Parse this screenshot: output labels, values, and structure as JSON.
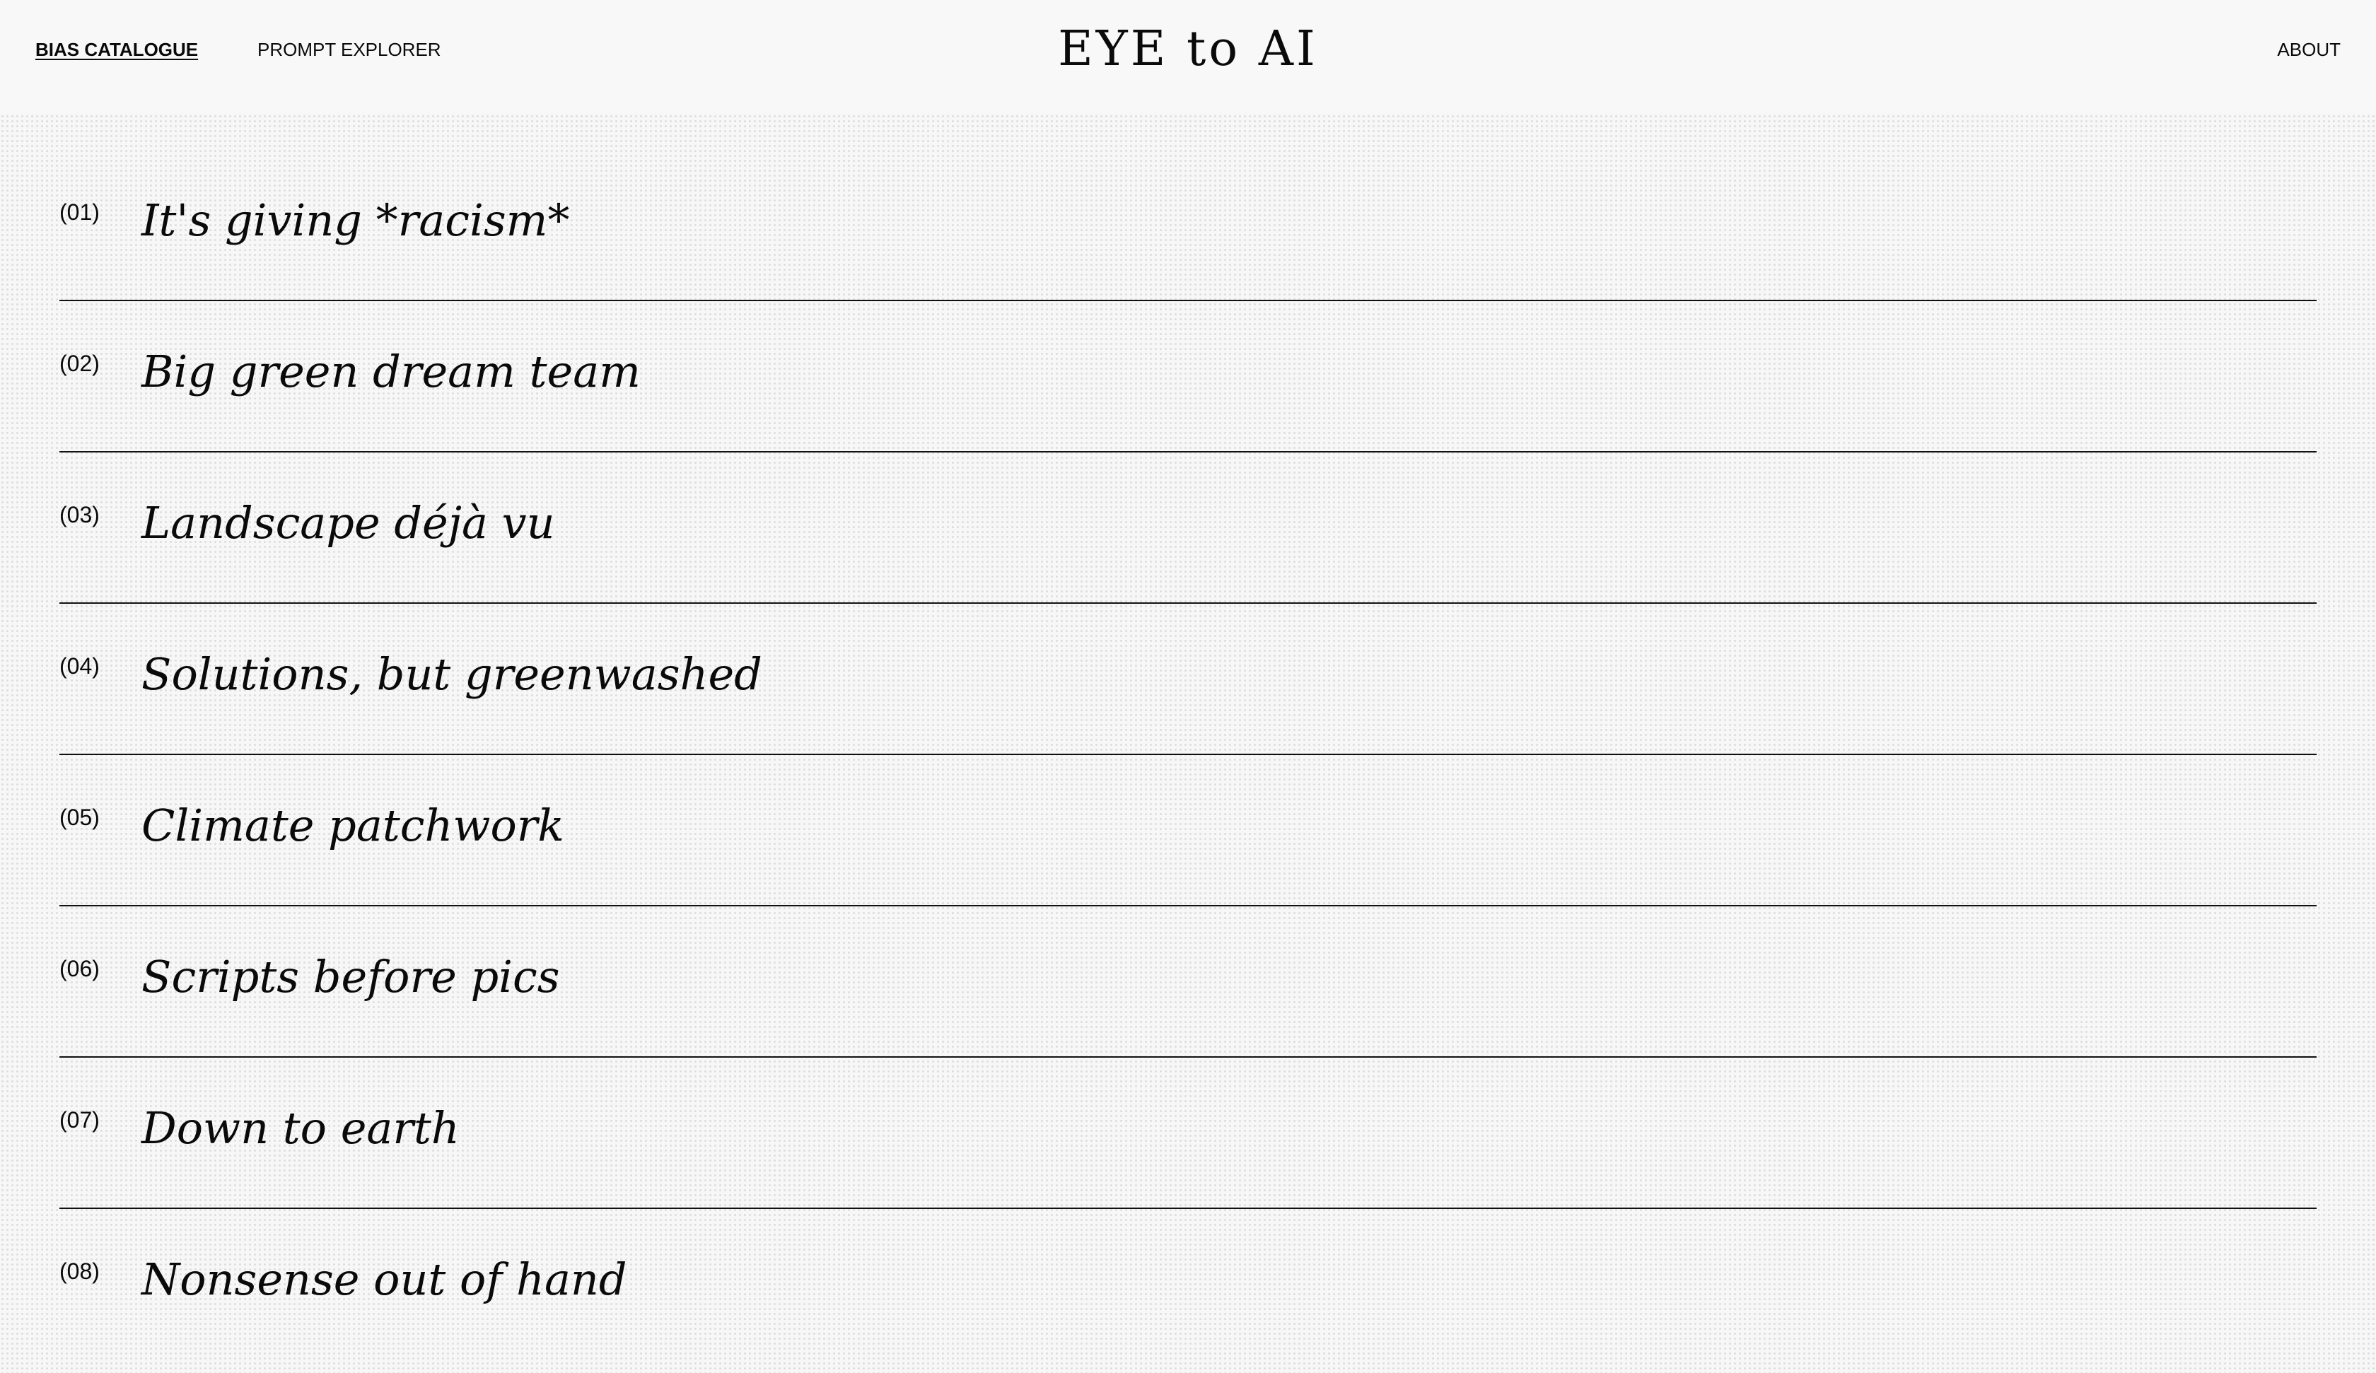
{
  "header": {
    "nav": {
      "bias_catalogue": "BIAS CATALOGUE",
      "prompt_explorer": "PROMPT EXPLORER",
      "about": "ABOUT"
    },
    "logo": "EYE to AI"
  },
  "catalogue": {
    "items": [
      {
        "number": "(01)",
        "title": "It's giving *racism*"
      },
      {
        "number": "(02)",
        "title": "Big green dream team"
      },
      {
        "number": "(03)",
        "title": "Landscape déjà vu"
      },
      {
        "number": "(04)",
        "title": "Solutions, but greenwashed"
      },
      {
        "number": "(05)",
        "title": "Climate patchwork"
      },
      {
        "number": "(06)",
        "title": "Scripts before pics"
      },
      {
        "number": "(07)",
        "title": "Down to earth"
      },
      {
        "number": "(08)",
        "title": "Nonsense out of hand"
      }
    ]
  },
  "colors": {
    "background": "#f7f7f7",
    "text": "#0a0a0a",
    "divider": "#111111"
  }
}
